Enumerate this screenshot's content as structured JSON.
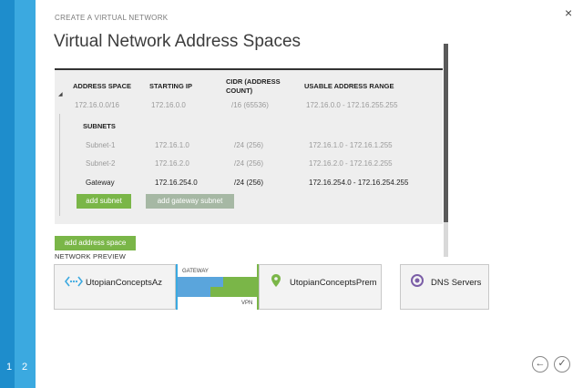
{
  "wizard": {
    "label": "CREATE A VIRTUAL NETWORK",
    "title": "Virtual Network Address Spaces",
    "steps": [
      "1",
      "2"
    ],
    "close_glyph": "×"
  },
  "table": {
    "headers": {
      "address_space": "ADDRESS SPACE",
      "starting_ip": "STARTING IP",
      "cidr_line1": "CIDR (ADDRESS",
      "cidr_line2": "COUNT)",
      "usable_range": "USABLE ADDRESS RANGE"
    },
    "address_space_row": {
      "address_space": "172.16.0.0/16",
      "starting_ip": "172.16.0.0",
      "cidr": "/16 (65536)",
      "range": "172.16.0.0 - 172.16.255.255"
    },
    "subnets_title": "SUBNETS",
    "subnets": [
      {
        "name": "Subnet-1",
        "starting_ip": "172.16.1.0",
        "cidr": "/24 (256)",
        "range": "172.16.1.0 - 172.16.1.255"
      },
      {
        "name": "Subnet-2",
        "starting_ip": "172.16.2.0",
        "cidr": "/24 (256)",
        "range": "172.16.2.0 - 172.16.2.255"
      },
      {
        "name": "Gateway",
        "starting_ip": "172.16.254.0",
        "cidr": "/24 (256)",
        "range": "172.16.254.0 - 172.16.254.255"
      }
    ],
    "add_subnet": "add subnet",
    "add_gateway_subnet": "add gateway subnet"
  },
  "add_address_space": "add address space",
  "preview": {
    "title": "NETWORK PREVIEW",
    "vnet_name": "UtopianConceptsAz",
    "local_name": "UtopianConceptsPrem",
    "dns_label": "DNS Servers",
    "gateway_label": "GATEWAY",
    "vpn_label": "VPN"
  },
  "colors": {
    "accent_blue": "#3ba9e0",
    "green": "#7ab648",
    "gateway_blue": "#5aa5dc",
    "dns_purple": "#7b5ea7"
  }
}
